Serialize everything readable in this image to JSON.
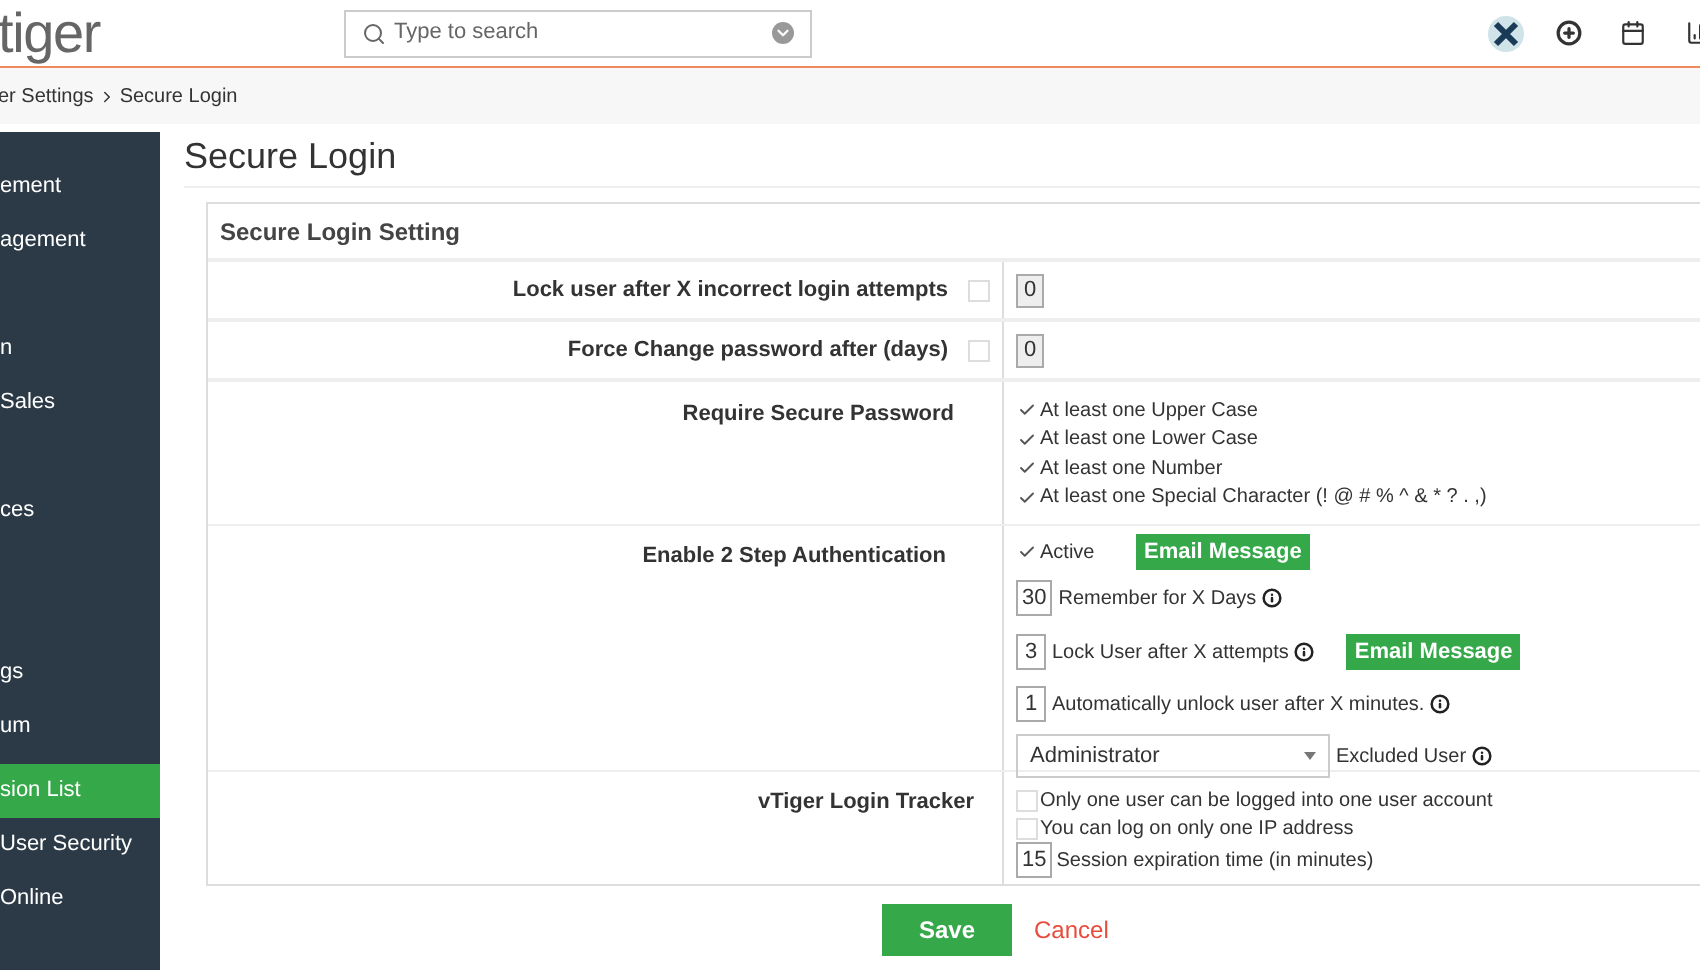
{
  "header": {
    "logo": "tiger",
    "search": {
      "placeholder": "Type to search"
    }
  },
  "breadcrumb": [
    "er Settings",
    "Secure Login"
  ],
  "sidebar": {
    "items": [
      {
        "label": "ement",
        "selected": false
      },
      {
        "label": "agement",
        "selected": false
      },
      {
        "label": "n",
        "selected": false
      },
      {
        "label": "Sales",
        "selected": false
      },
      {
        "label": "ces",
        "selected": false
      },
      {
        "label": "gs",
        "selected": false
      },
      {
        "label": "um",
        "selected": false
      },
      {
        "label": "sion List",
        "selected": true
      },
      {
        "label": "User Security",
        "selected": false
      },
      {
        "label": "Online",
        "selected": false
      }
    ]
  },
  "page_title": "Secure Login",
  "panel": {
    "title": "Secure Login Setting",
    "lock_attempts": {
      "label": "Lock user after X incorrect login attempts",
      "checked": false,
      "value": "0"
    },
    "force_change": {
      "label": "Force Change password after (days)",
      "checked": false,
      "value": "0"
    },
    "secure_password": {
      "label": "Require Secure Password",
      "options": [
        {
          "label": "At least one Upper Case",
          "checked": true
        },
        {
          "label": "At least one Lower Case",
          "checked": true
        },
        {
          "label": "At least one Number",
          "checked": true
        },
        {
          "label": "At least one Special Character (! @ # % ^ & * ? . ,)",
          "checked": true
        }
      ]
    },
    "two_step": {
      "label": "Enable 2 Step Authentication",
      "active": {
        "label": "Active",
        "checked": true
      },
      "email_button": "Email Message",
      "remember": {
        "value": "30",
        "label": "Remember for X Days"
      },
      "lock_user": {
        "value": "3",
        "label": "Lock User after X attempts",
        "email_button": "Email Message"
      },
      "unlock": {
        "value": "1",
        "label": "Automatically unlock user after X minutes."
      },
      "excluded": {
        "value": "Administrator",
        "label": "Excluded User"
      }
    },
    "tracker": {
      "label": "vTiger Login Tracker",
      "options": [
        {
          "label": "Only one user can be logged into one user account",
          "checked": false
        },
        {
          "label": "You can log on only one IP address",
          "checked": false
        }
      ],
      "session": {
        "value": "15",
        "label": "Session expiration time (in minutes)"
      }
    }
  },
  "actions": {
    "save": "Save",
    "cancel": "Cancel"
  }
}
